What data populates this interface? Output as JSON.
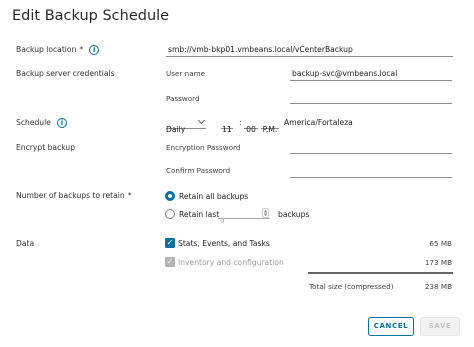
{
  "dialog": {
    "title": "Edit Backup Schedule"
  },
  "location": {
    "label": "Backup location",
    "required_mark": "*",
    "value": "smb://vmb-bkp01.vmbeans.local/vCenterBackup"
  },
  "credentials": {
    "label": "Backup server credentials",
    "username_label": "User name",
    "username_value": "backup-svc@vmbeans.local",
    "password_label": "Password",
    "password_value": ""
  },
  "schedule": {
    "label": "Schedule",
    "frequency": "Daily",
    "hour": "11",
    "separator": ":",
    "minute": "00",
    "ampm": "P.M.",
    "timezone": "America/Fortaleza"
  },
  "encrypt": {
    "label": "Encrypt backup",
    "encryption_password_label": "Encryption Password",
    "confirm_password_label": "Confirm Password"
  },
  "retain": {
    "label": "Number of backups to retain",
    "required_mark": "*",
    "option_all": "Retain all backups",
    "option_last": "Retain last",
    "last_count": "0",
    "suffix": "backups",
    "selected": "all"
  },
  "data": {
    "label": "Data",
    "items": [
      {
        "label": "Stats, Events, and Tasks",
        "size": "65 MB",
        "checked": true,
        "disabled": false
      },
      {
        "label": "Inventory and configuration",
        "size": "173 MB",
        "checked": true,
        "disabled": true
      }
    ],
    "total_label": "Total size (compressed)",
    "total_value": "238 MB"
  },
  "buttons": {
    "cancel": "CANCEL",
    "save": "SAVE"
  },
  "colors": {
    "accent": "#0072a3",
    "disabled": "#b3b3b3"
  }
}
